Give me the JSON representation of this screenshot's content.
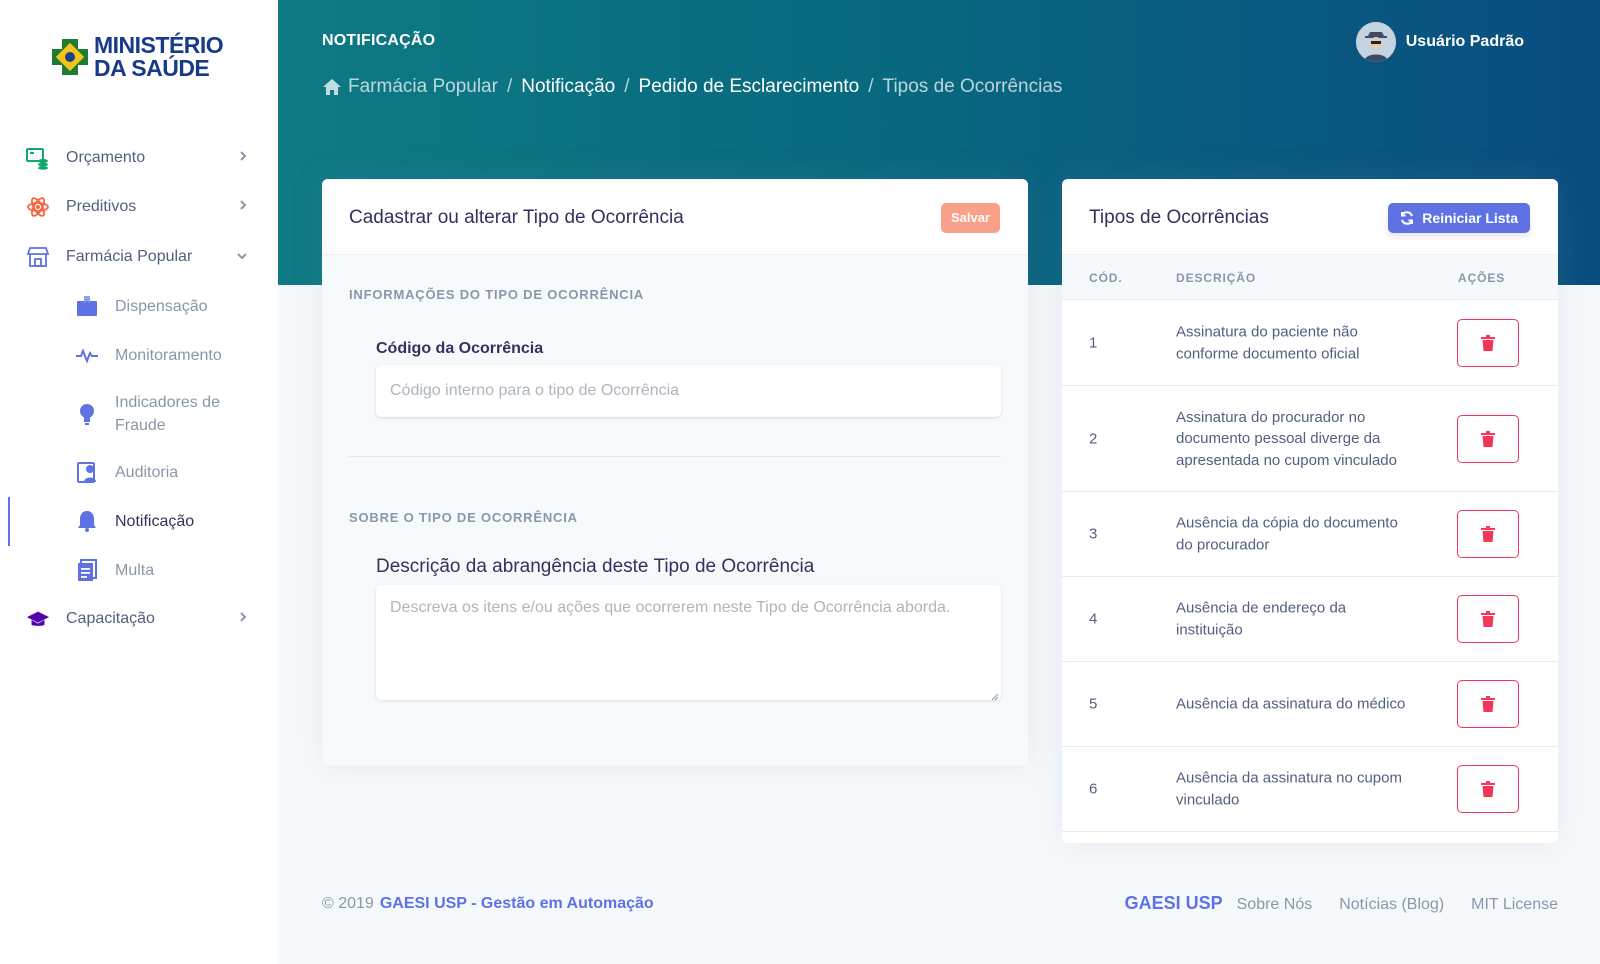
{
  "logo": {
    "line1": "MINISTÉRIO",
    "line2": "DA SAÚDE"
  },
  "sidebar": {
    "items": [
      {
        "label": "Orçamento",
        "icon": "budget-icon",
        "color": "#2dce89"
      },
      {
        "label": "Preditivos",
        "icon": "atom-icon",
        "color": "#fb6340"
      },
      {
        "label": "Farmácia Popular",
        "icon": "store-icon",
        "color": "#5e72e4"
      }
    ],
    "subitems": [
      {
        "label": "Dispensação",
        "icon": "box-icon"
      },
      {
        "label": "Monitoramento",
        "icon": "heartbeat-icon"
      },
      {
        "label": "Indicadores de Fraude",
        "icon": "lightbulb-icon"
      },
      {
        "label": "Auditoria",
        "icon": "audit-icon"
      },
      {
        "label": "Notificação",
        "icon": "bell-icon"
      },
      {
        "label": "Multa",
        "icon": "document-icon"
      }
    ],
    "bottom_item": {
      "label": "Capacitação",
      "icon": "graduation-cap-icon",
      "color": "#5603ad"
    },
    "active": "Notificação"
  },
  "header": {
    "title": "NOTIFICAÇÃO",
    "breadcrumb": [
      "Farmácia Popular",
      "Notificação",
      "Pedido de Esclarecimento",
      "Tipos de Ocorrências"
    ],
    "user_name": "Usuário Padrão"
  },
  "form_card": {
    "title": "Cadastrar ou alterar Tipo de Ocorrência",
    "save_label": "Salvar",
    "section1": "INFORMAÇÕES DO TIPO DE OCORRÊNCIA",
    "code_label": "Código da Ocorrência",
    "code_placeholder": "Código interno para o tipo de Ocorrência",
    "section2": "SOBRE O TIPO DE OCORRÊNCIA",
    "desc_label": "Descrição da abrangência deste Tipo de Ocorrência",
    "desc_placeholder": "Descreva os itens e/ou ações que ocorrerem neste Tipo de Ocorrência aborda."
  },
  "list_card": {
    "title": "Tipos de Ocorrências",
    "reset_label": "Reiniciar Lista",
    "columns": [
      "CÓD.",
      "DESCRIÇÃO",
      "AÇÕES"
    ],
    "rows": [
      {
        "cod": "1",
        "desc": "Assinatura do paciente não conforme documento oficial"
      },
      {
        "cod": "2",
        "desc": "Assinatura do procurador  no documento pessoal diverge da apresentada no cupom vinculado"
      },
      {
        "cod": "3",
        "desc": "Ausência da cópia do documento do procurador"
      },
      {
        "cod": "4",
        "desc": "Ausência de endereço da instituição"
      },
      {
        "cod": "5",
        "desc": "Ausência da assinatura do médico"
      },
      {
        "cod": "6",
        "desc": "Ausência da assinatura no cupom vinculado"
      }
    ]
  },
  "footer": {
    "copyright": "© 2019",
    "org_link": "GAESI USP - Gestão em Automação",
    "brand": "GAESI USP",
    "links": [
      "Sobre Nós",
      "Notícias (Blog)",
      "MIT License"
    ]
  },
  "colors": {
    "primary": "#5e72e4",
    "danger": "#f5365c",
    "header_start": "#0e7a84",
    "header_end": "#0a4d80"
  }
}
